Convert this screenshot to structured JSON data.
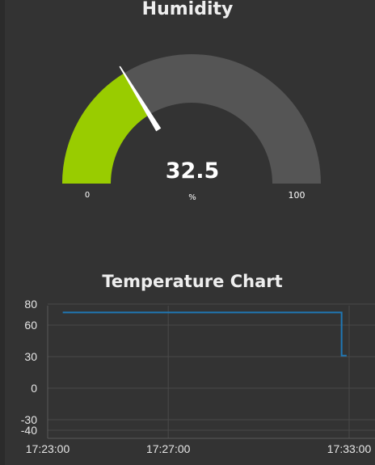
{
  "gauge": {
    "title": "Humidity",
    "value": 32.5,
    "value_text": "32.5",
    "unit": "%",
    "min": 0,
    "max": 100,
    "min_label": "0",
    "max_label": "100",
    "fill_color": "#99cc00",
    "track_color": "#555555",
    "needle_color": "#ffffff"
  },
  "chart": {
    "title": "Temperature Chart"
  },
  "chart_data": {
    "type": "line",
    "title": "Temperature Chart",
    "xlabel": "",
    "ylabel": "",
    "x_tick_labels": [
      "17:23:00",
      "17:27:00",
      "17:33:00"
    ],
    "y_tick_labels": [
      "80",
      "60",
      "30",
      "0",
      "-30",
      "-40"
    ],
    "y_ticks": [
      80,
      60,
      30,
      0,
      -30,
      -40
    ],
    "x_ticks": [
      "17:23:00",
      "17:27:00",
      "17:33:00"
    ],
    "xlim": [
      "17:23:00",
      "17:33:00"
    ],
    "ylim": [
      -40,
      80
    ],
    "grid": true,
    "series": [
      {
        "color": "#1f77b4",
        "x": [
          "17:23:30",
          "17:32:45",
          "17:32:45",
          "17:32:55"
        ],
        "y": [
          72,
          72,
          31,
          31
        ]
      }
    ]
  }
}
